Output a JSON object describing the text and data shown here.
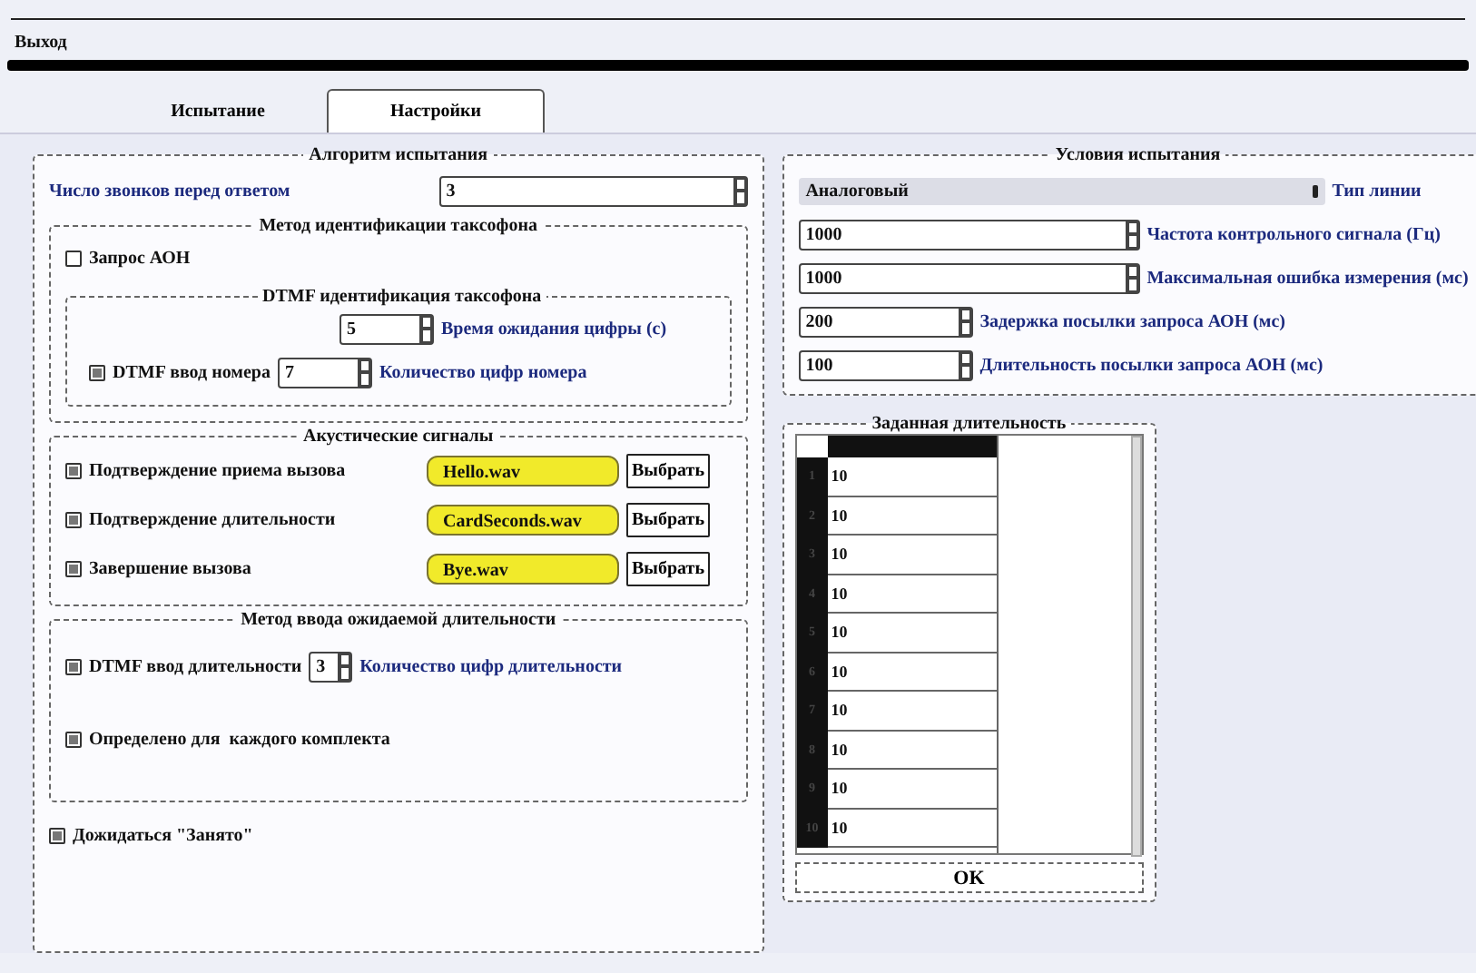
{
  "menu": [
    {
      "label": "Выход"
    }
  ],
  "tabs": [
    {
      "label": "Испытание",
      "selected": false
    },
    {
      "label": "Настройки",
      "selected": true
    }
  ],
  "algorithm": {
    "title": "Алгоритм испытания",
    "rings": {
      "label": "Число звонков перед ответом",
      "value": "3"
    },
    "identification": {
      "title": "Метод идентификации таксофона",
      "aon_request": {
        "label": "Запрос АОН",
        "checked": false
      },
      "dtmf": {
        "title": "DTMF идентификация таксофона",
        "wait": {
          "value": "5",
          "label": "Время ожидания цифры (с)"
        },
        "number": {
          "label": "DTMF ввод номера",
          "checked": true,
          "value": "7",
          "count_label": "Количество цифр номера"
        }
      }
    },
    "acoustic": {
      "title": "Акустические сигналы",
      "signals": [
        {
          "label": "Подтверждение приема вызова",
          "checked": true,
          "file": "Hello.wav",
          "button": "Выбрать"
        },
        {
          "label": "Подтверждение длительности",
          "checked": true,
          "file": "CardSeconds.wav",
          "button": "Выбрать"
        },
        {
          "label": "Завершение вызова",
          "checked": true,
          "file": "Bye.wav",
          "button": "Выбрать"
        }
      ]
    },
    "duration_input": {
      "title": "Метод ввода ожидаемой длительности",
      "dtmf": {
        "label": "DTMF ввод длительности",
        "checked": true,
        "value": "3",
        "count_label": "Количество цифр длительности"
      },
      "per_set": {
        "label": "Определено для  каждого комплекта",
        "checked": true
      }
    },
    "wait_busy": {
      "label": "Дожидаться \"Занято\"",
      "checked": true
    }
  },
  "conditions": {
    "title": "Условия испытания",
    "line_type": {
      "value": "Аналоговый",
      "label": "Тип линии"
    },
    "fields": [
      {
        "kind": "wide",
        "value": "1000",
        "label": "Частота контрольного сигнала (Гц)"
      },
      {
        "kind": "wide",
        "value": "1000",
        "label": "Максимальная ошибка измерения (мс)"
      },
      {
        "kind": "narrow",
        "value": "200",
        "label": "Задержка посылки запроса АОН (мс)"
      },
      {
        "kind": "narrow",
        "value": "100",
        "label": "Длительность посылки запроса АОН (мс)"
      }
    ]
  },
  "durations": {
    "title": "Заданная длительность",
    "rows": [
      {
        "index": "1",
        "value": "10"
      },
      {
        "index": "2",
        "value": "10"
      },
      {
        "index": "3",
        "value": "10"
      },
      {
        "index": "4",
        "value": "10"
      },
      {
        "index": "5",
        "value": "10"
      },
      {
        "index": "6",
        "value": "10"
      },
      {
        "index": "7",
        "value": "10"
      },
      {
        "index": "8",
        "value": "10"
      },
      {
        "index": "9",
        "value": "10"
      },
      {
        "index": "10",
        "value": "10"
      }
    ],
    "button": "OK"
  }
}
